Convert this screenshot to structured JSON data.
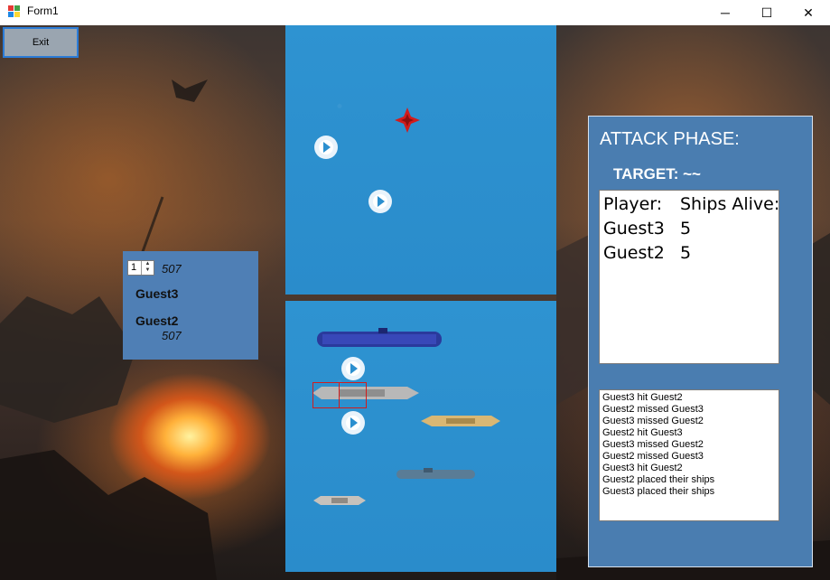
{
  "window": {
    "title": "Form1",
    "minimize_glyph": "─",
    "maximize_glyph": "☐",
    "close_glyph": "✕"
  },
  "toolbar": {
    "exit_label": "Exit"
  },
  "players_panel": {
    "spinner_value": "1",
    "spinner_up": "▲",
    "spinner_down": "▼",
    "number_top": "507",
    "player1": "Guest3",
    "player2": "Guest2",
    "number_bottom": "507"
  },
  "attack_panel": {
    "phase_title": "ATTACK PHASE:",
    "target_label": "TARGET: ~~",
    "stats_header": {
      "player": "Player:",
      "ships": "Ships Alive:"
    },
    "stats_rows": [
      {
        "player": "Guest3",
        "ships": "5"
      },
      {
        "player": "Guest2",
        "ships": "5"
      }
    ],
    "log": [
      "Guest3 hit Guest2",
      "Guest2 missed Guest3",
      "Guest3 missed Guest2",
      "Guest2 hit Guest3",
      "Guest3 missed Guest2",
      "Guest2 missed Guest3",
      "Guest3 hit Guest2",
      "Guest2 placed their ships",
      "Guest3 placed their ships"
    ]
  },
  "icons": {
    "app": "form-app-icon",
    "miss": "splash-miss-icon",
    "hit": "hit-x-icon"
  },
  "colors": {
    "ocean": "#2b8fcf",
    "panel": "#4a7db0",
    "left_panel": "#4f7fb5",
    "hit": "#d21c1c",
    "selection": "#d21c1c"
  }
}
